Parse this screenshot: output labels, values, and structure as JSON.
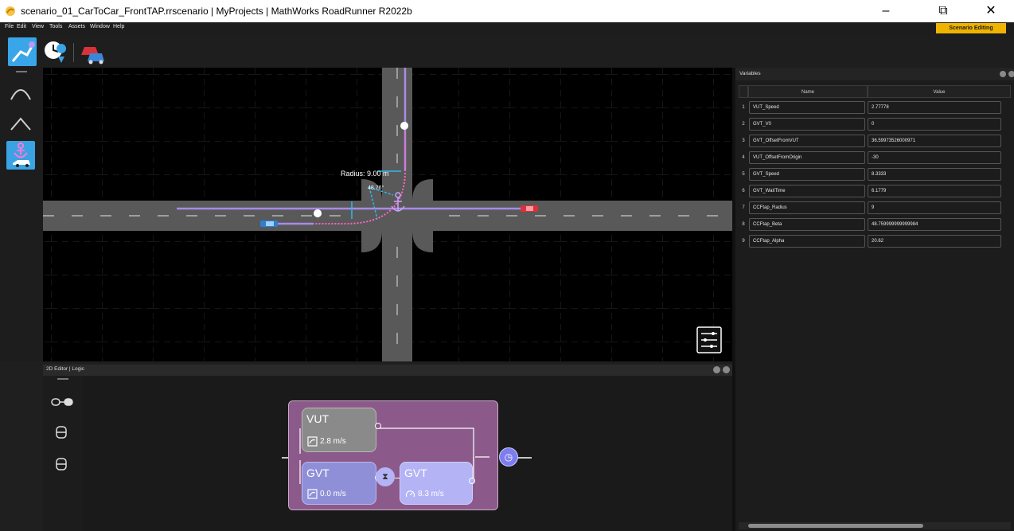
{
  "window": {
    "title": "scenario_01_CarToCar_FrontTAP.rrscenario | MyProjects | MathWorks RoadRunner R2022b",
    "minimize": "–",
    "restore": "⧉",
    "close": "✕"
  },
  "menu": [
    "File",
    "Edit",
    "View",
    "Tools",
    "Assets",
    "Window",
    "Help"
  ],
  "mode_badge": "Scenario Editing",
  "toolbar": {
    "tools": [
      "path-tool-icon",
      "scenario-timing-icon",
      "vehicle-assets-icon"
    ]
  },
  "left_tools": [
    "arc-tool-icon",
    "peak-tool-icon",
    "anchor-tool-icon"
  ],
  "viewport": {
    "radius_label": "Radius: 9.00 m",
    "angle_label": "48.76°"
  },
  "editor": {
    "header": "2D Editor | Logic",
    "side_tools": [
      "link-tool-icon",
      "vehicle-node-icon",
      "vehicle-node-icon-2"
    ],
    "nodes": [
      {
        "title": "VUT",
        "speed": "2.8 m/s",
        "icon": "path-speed-icon"
      },
      {
        "title": "GVT",
        "speed": "0.0 m/s",
        "icon": "path-speed-icon"
      },
      {
        "title": "GVT",
        "speed": "8.3 m/s",
        "icon": "speedometer-icon"
      }
    ]
  },
  "variables": {
    "header": "Variables",
    "columns": [
      "Name",
      "Value"
    ],
    "rows": [
      {
        "index": "1",
        "name": "VUT_Speed",
        "value": "2.77778"
      },
      {
        "index": "2",
        "name": "GVT_V0",
        "value": "0"
      },
      {
        "index": "3",
        "name": "GVT_OffsetFromVUT",
        "value": "36.59973526000971"
      },
      {
        "index": "4",
        "name": "VUT_OffsetFromOrigin",
        "value": "-30"
      },
      {
        "index": "5",
        "name": "GVT_Speed",
        "value": "8.3333"
      },
      {
        "index": "6",
        "name": "GVT_WaitTime",
        "value": "6.1779"
      },
      {
        "index": "7",
        "name": "CCFtap_Radius",
        "value": "9"
      },
      {
        "index": "8",
        "name": "CCFtap_Beta",
        "value": "48.759999999999984"
      },
      {
        "index": "9",
        "name": "CCFtap_Alpha",
        "value": "20.62"
      }
    ]
  },
  "colors": {
    "accent": "#f0b400",
    "path": "#a98be8",
    "trajectory": "#ff66c4",
    "road": "#595959",
    "logic_group": "#8b5a8a",
    "node_vut": "#8a8a8a",
    "node_gvt": "#8f8fd8",
    "node_gvt2": "#b3b3f5"
  }
}
